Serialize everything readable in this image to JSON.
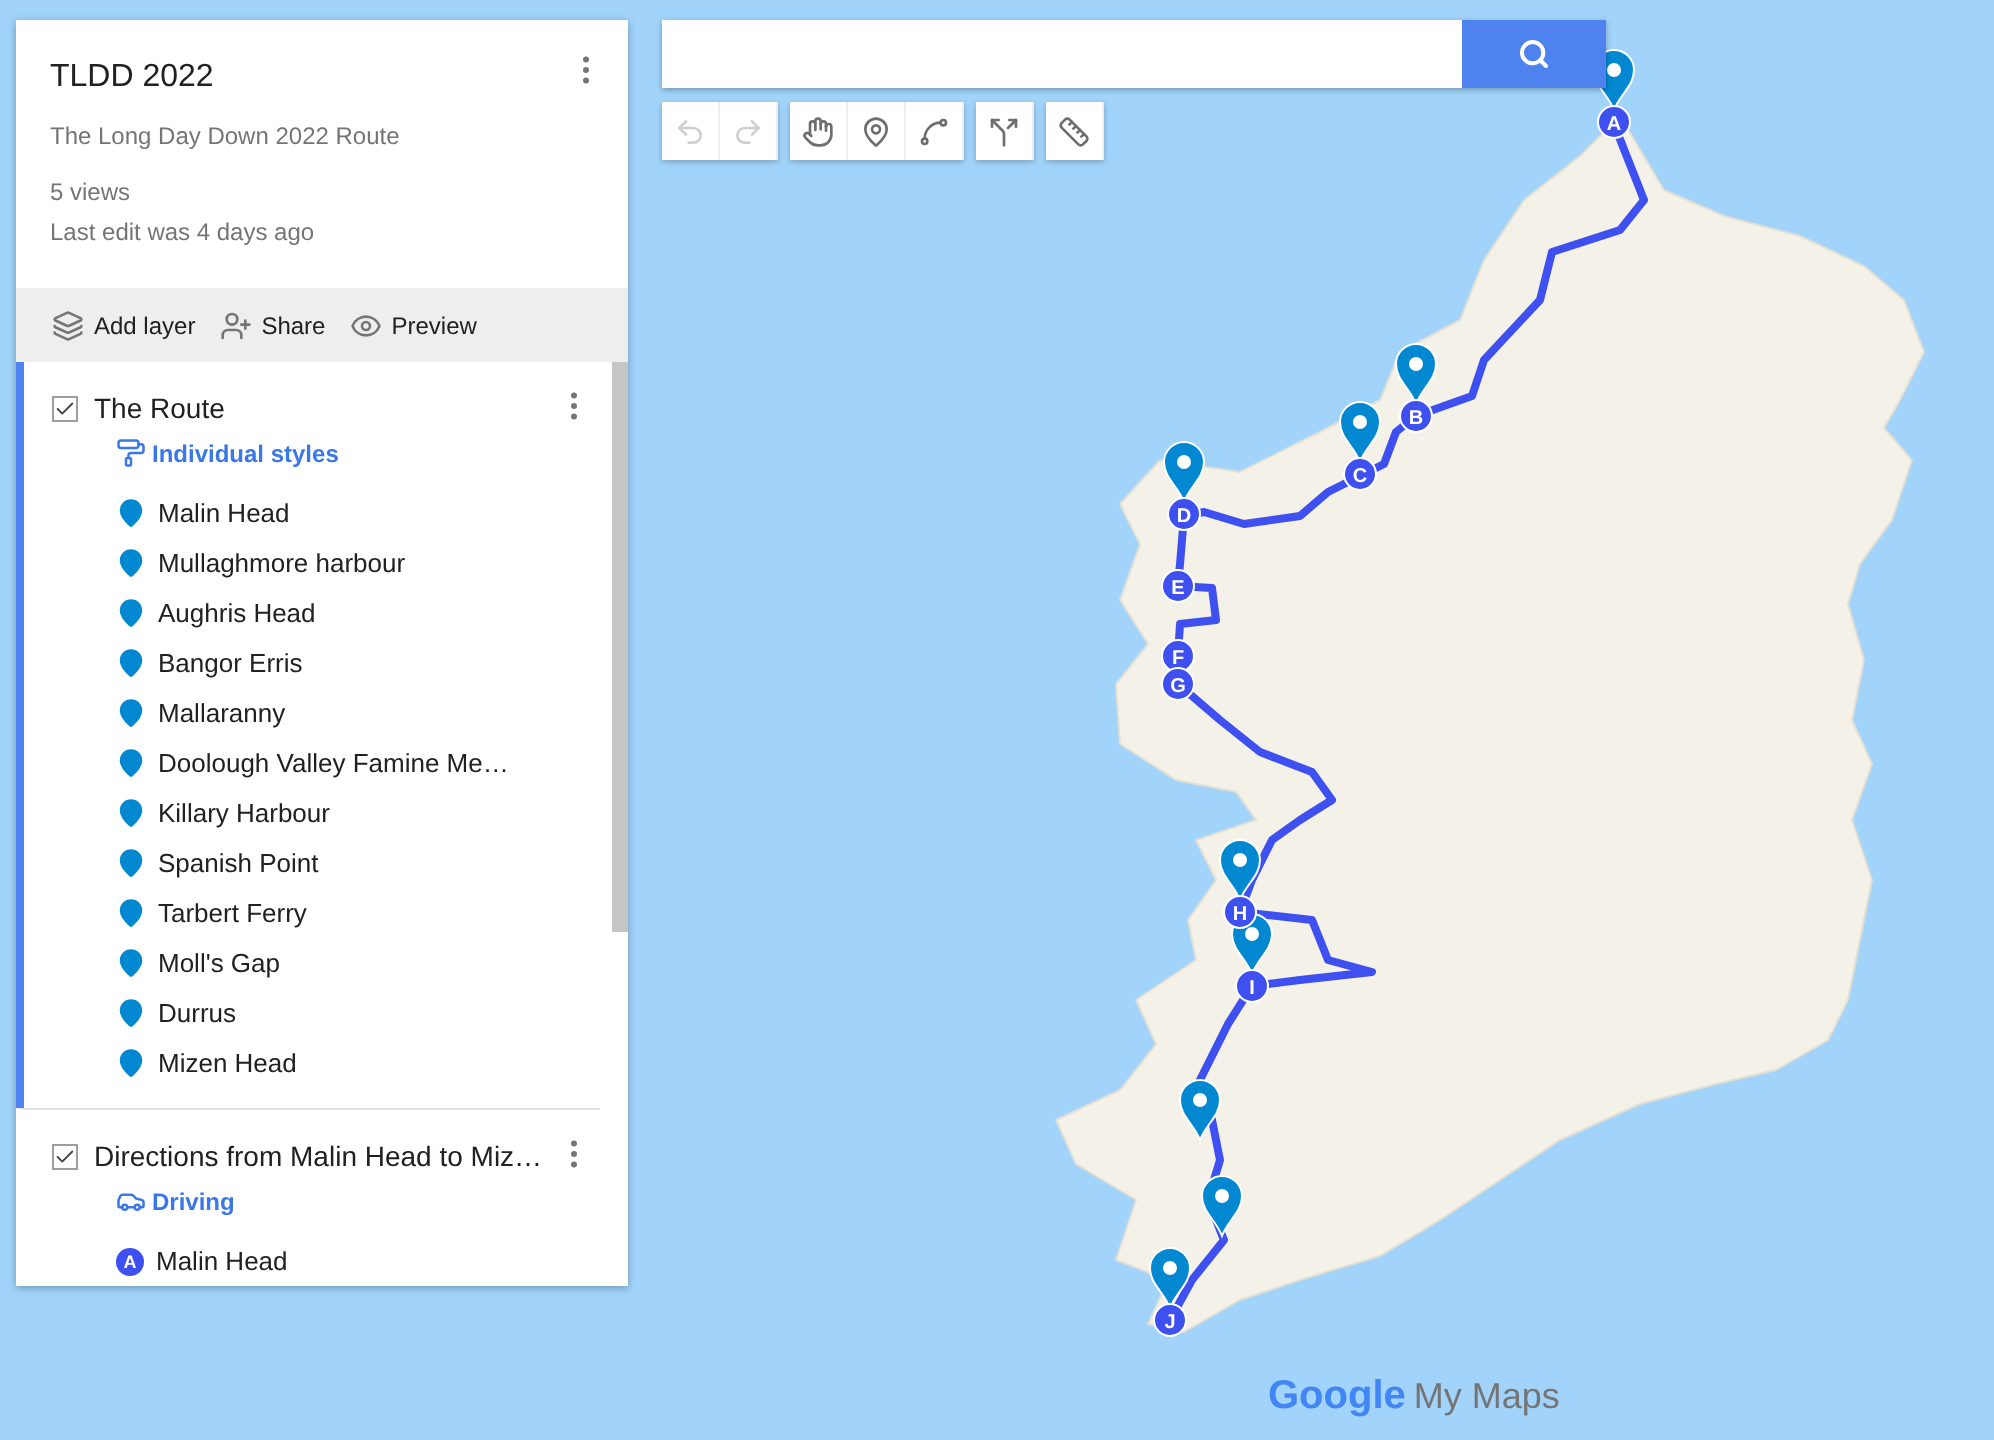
{
  "map": {
    "title": "TLDD 2022",
    "description": "The Long Day Down 2022 Route",
    "views": "5 views",
    "last_edit": "Last edit was 4 days ago"
  },
  "actions": [
    {
      "kind": "add_layer",
      "label": "Add layer"
    },
    {
      "kind": "share",
      "label": "Share"
    },
    {
      "kind": "preview",
      "label": "Preview"
    }
  ],
  "layers": [
    {
      "name": "The Route",
      "checked": true,
      "selected": true,
      "style": {
        "kind": "styles",
        "label": "Individual styles"
      },
      "items": [
        {
          "kind": "pin",
          "label": "Malin Head"
        },
        {
          "kind": "pin",
          "label": "Mullaghmore harbour"
        },
        {
          "kind": "pin",
          "label": "Aughris Head"
        },
        {
          "kind": "pin",
          "label": "Bangor Erris"
        },
        {
          "kind": "pin",
          "label": "Mallaranny"
        },
        {
          "kind": "pin",
          "label": "Doolough Valley Famine Me…"
        },
        {
          "kind": "pin",
          "label": "Killary Harbour"
        },
        {
          "kind": "pin",
          "label": "Spanish Point"
        },
        {
          "kind": "pin",
          "label": "Tarbert Ferry"
        },
        {
          "kind": "pin",
          "label": "Moll's Gap"
        },
        {
          "kind": "pin",
          "label": "Durrus"
        },
        {
          "kind": "pin",
          "label": "Mizen Head"
        }
      ]
    },
    {
      "name": "Directions from Malin Head to Miz…",
      "checked": true,
      "selected": false,
      "style": {
        "kind": "driving",
        "label": "Driving"
      },
      "items": [
        {
          "kind": "letter",
          "letter": "A",
          "label": "Malin Head"
        }
      ]
    }
  ],
  "tool_groups": [
    {
      "tools": [
        {
          "kind": "undo",
          "disabled": true
        },
        {
          "kind": "redo",
          "disabled": true
        }
      ]
    },
    {
      "tools": [
        {
          "kind": "hand",
          "disabled": false
        },
        {
          "kind": "pin",
          "disabled": false
        },
        {
          "kind": "line",
          "disabled": false
        }
      ]
    },
    {
      "tools": [
        {
          "kind": "route",
          "disabled": false
        }
      ]
    },
    {
      "tools": [
        {
          "kind": "ruler",
          "disabled": false
        }
      ]
    }
  ],
  "stops": [
    {
      "letter": "A"
    },
    {
      "letter": "B"
    },
    {
      "letter": "C"
    },
    {
      "letter": "D"
    },
    {
      "letter": "E"
    },
    {
      "letter": "F"
    },
    {
      "letter": "G"
    },
    {
      "letter": "H"
    },
    {
      "letter": "I"
    },
    {
      "letter": "J"
    }
  ],
  "attribution": {
    "logo": "Google",
    "product": "My Maps"
  }
}
